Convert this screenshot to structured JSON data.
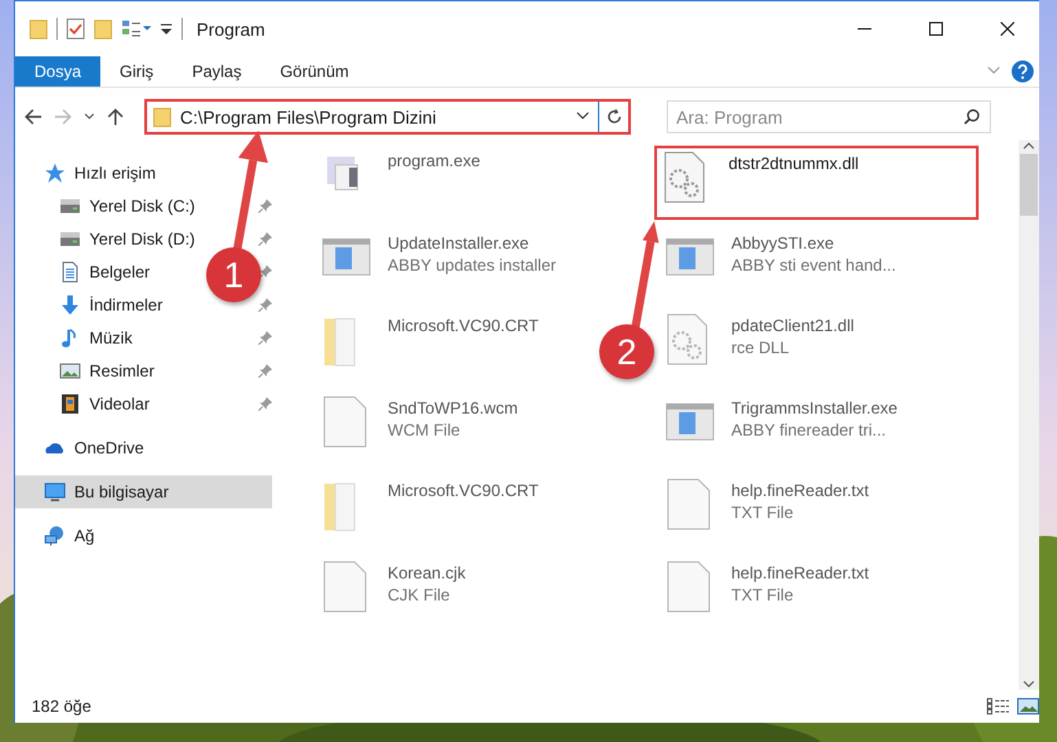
{
  "window": {
    "title": "Program"
  },
  "ribbon": {
    "tabs": [
      {
        "label": "Dosya",
        "selected": true
      },
      {
        "label": "Giriş",
        "selected": false
      },
      {
        "label": "Paylaş",
        "selected": false
      },
      {
        "label": "Görünüm",
        "selected": false
      }
    ]
  },
  "address_bar": {
    "path": "C:\\Program Files\\Program Dizini",
    "highlighted": true
  },
  "search": {
    "placeholder": "Ara: Program"
  },
  "sidebar": {
    "items": [
      {
        "label": "Hızlı erişim",
        "kind": "star",
        "selected": false,
        "children": [
          {
            "label": "Yerel Disk (C:)",
            "kind": "drive",
            "pinned": true,
            "selected": false
          },
          {
            "label": "Yerel Disk (D:)",
            "kind": "drive",
            "pinned": true,
            "selected": false
          },
          {
            "label": "Belgeler",
            "kind": "documents",
            "pinned": true,
            "selected": false
          },
          {
            "label": "İndirmeler",
            "kind": "downloads",
            "pinned": true,
            "selected": false
          },
          {
            "label": "Müzik",
            "kind": "music",
            "pinned": true,
            "selected": false
          },
          {
            "label": "Resimler",
            "kind": "pictures",
            "pinned": true,
            "selected": false
          },
          {
            "label": "Videolar",
            "kind": "videos",
            "pinned": true,
            "selected": false
          }
        ]
      },
      {
        "label": "OneDrive",
        "kind": "cloud",
        "selected": false
      },
      {
        "label": "Bu bilgisayar",
        "kind": "computer",
        "selected": true
      },
      {
        "label": "Ağ",
        "kind": "network",
        "selected": false
      }
    ]
  },
  "files": [
    {
      "name": "program.exe",
      "kind": "app",
      "blurred": true,
      "highlighted": false
    },
    {
      "name": "dtstr2dtnummx.dll",
      "kind": "dll",
      "blurred": false,
      "highlighted": true
    },
    {
      "name": "UpdateInstaller.exe",
      "description": "ABBY updates installer",
      "kind": "installer",
      "blurred": true,
      "highlighted": false
    },
    {
      "name": "AbbyySTI.exe",
      "description": "ABBY sti event hand...",
      "kind": "installer",
      "blurred": true,
      "highlighted": false
    },
    {
      "name": "Microsoft.VC90.CRT",
      "kind": "folder",
      "blurred": true,
      "highlighted": false
    },
    {
      "name": "pdateClient21.dll",
      "description": "rce DLL",
      "kind": "dll",
      "blurred": true,
      "highlighted": false
    },
    {
      "name": "SndToWP16.wcm",
      "description": "WCM File",
      "kind": "file",
      "blurred": true,
      "highlighted": false
    },
    {
      "name": "TrigrammsInstaller.exe",
      "description": "ABBY finereader tri...",
      "kind": "installer",
      "blurred": true,
      "highlighted": false
    },
    {
      "name": "Microsoft.VC90.CRT",
      "kind": "folder",
      "blurred": true,
      "highlighted": false
    },
    {
      "name": "help.fineReader.txt",
      "description": "TXT File",
      "kind": "file",
      "blurred": true,
      "highlighted": false
    },
    {
      "name": "Korean.cjk",
      "description": "CJK File",
      "kind": "file",
      "blurred": true,
      "highlighted": false
    },
    {
      "name": "help.fineReader.txt",
      "description": "TXT File",
      "kind": "file",
      "blurred": true,
      "highlighted": false
    }
  ],
  "status_bar": {
    "count": "182 öğe"
  },
  "annotations": [
    {
      "label": "1"
    },
    {
      "label": "2"
    }
  ]
}
